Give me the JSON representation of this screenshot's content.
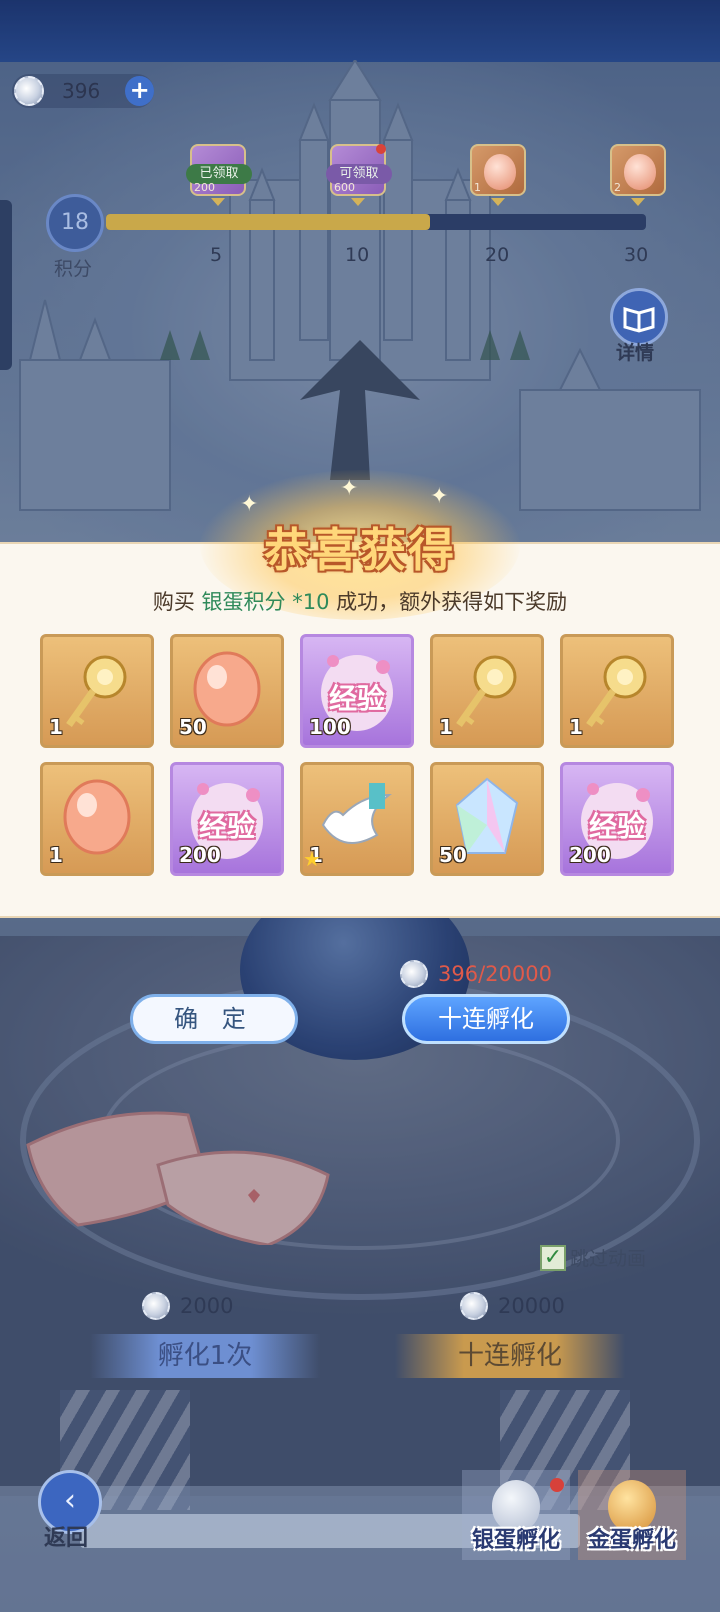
{
  "hud": {
    "currency_value": "396",
    "currency_plus": "+",
    "score_value": "18",
    "score_label": "积分",
    "progress_fraction": 0.6,
    "milestones": [
      {
        "tick": "5",
        "tag": "已领取",
        "amount": "200",
        "kind": "purple",
        "state": "claimed"
      },
      {
        "tick": "10",
        "tag": "可领取",
        "amount": "600",
        "kind": "purple",
        "state": "claimable"
      },
      {
        "tick": "20",
        "tag": "",
        "amount": "1",
        "kind": "orange",
        "state": "locked"
      },
      {
        "tick": "30",
        "tag": "",
        "amount": "2",
        "kind": "orange",
        "state": "locked"
      }
    ],
    "detail_label": "详情"
  },
  "modal": {
    "title": "恭喜获得",
    "msg_prefix": "购买 ",
    "msg_item": "银蛋积分",
    "msg_qty": " *10",
    "msg_suffix": " 成功，额外获得如下奖励",
    "items": [
      {
        "icon": "golden-key-icon",
        "count": "1",
        "bg": "orange"
      },
      {
        "icon": "orange-egg-icon",
        "count": "50",
        "bg": "orange"
      },
      {
        "icon": "exp-egg-icon",
        "count": "100",
        "bg": "purple",
        "text": "经验"
      },
      {
        "icon": "golden-key-icon",
        "count": "1",
        "bg": "orange"
      },
      {
        "icon": "golden-key-icon",
        "count": "1",
        "bg": "orange"
      },
      {
        "icon": "orange-egg-icon",
        "count": "1",
        "bg": "orange"
      },
      {
        "icon": "exp-egg-icon",
        "count": "200",
        "bg": "purple",
        "text": "经验"
      },
      {
        "icon": "white-wing-icon",
        "count": "1",
        "bg": "orange",
        "star": "★"
      },
      {
        "icon": "rainbow-crystal-icon",
        "count": "50",
        "bg": "orange"
      },
      {
        "icon": "exp-egg-icon",
        "count": "200",
        "bg": "purple",
        "text": "经验"
      }
    ]
  },
  "actions": {
    "confirm_label": "确 定",
    "ten_label": "十连孵化",
    "ten_cost": "396/20000",
    "skip_label": "跳过动画",
    "skip_checked": "✓",
    "hatch_one_cost": "2000",
    "hatch_one_label": "孵化1次",
    "hatch_ten_cost": "20000",
    "hatch_ten_label": "十连孵化"
  },
  "nav": {
    "back_label": "返回",
    "back_icon": "back-arrow-icon",
    "silver_label": "银蛋孵化",
    "gold_label": "金蛋孵化"
  },
  "colors": {
    "highlight_green": "#2f8a5a",
    "cost_red": "#e05a4a",
    "title_gold": "#ffd77a"
  }
}
